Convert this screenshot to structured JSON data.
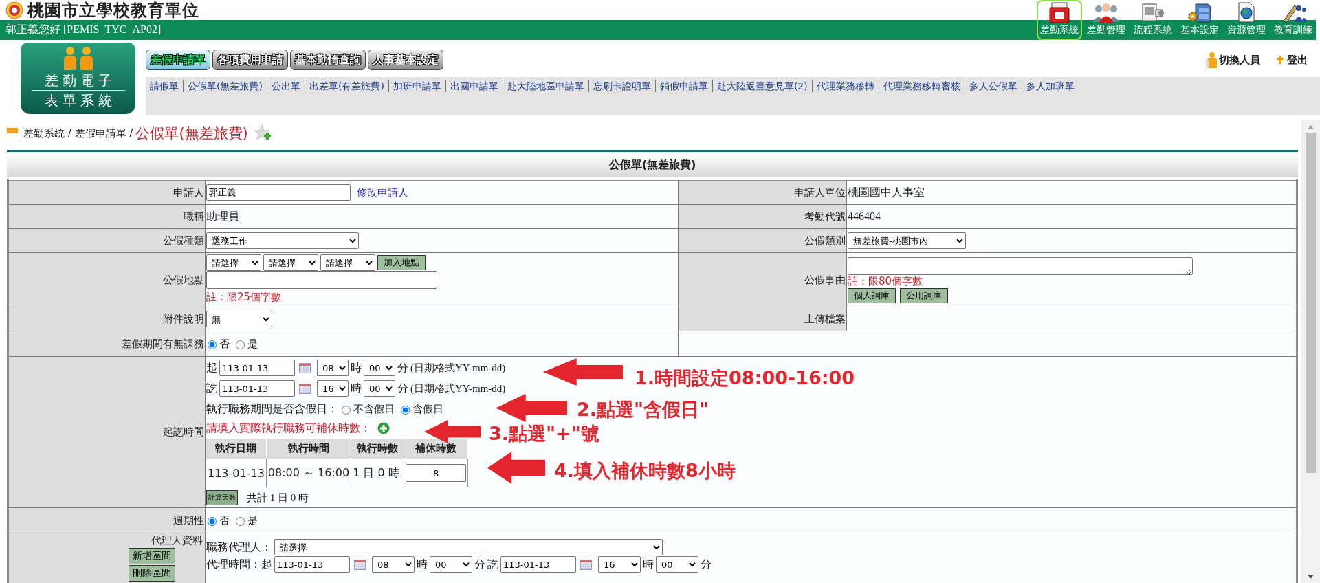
{
  "header": {
    "title": "桃園市立學校教育單位",
    "greeting": "郭正義您好 [PEMIS_TYC_AP02]",
    "systems": [
      {
        "label": "差勤系統",
        "selected": true
      },
      {
        "label": "差勤管理",
        "selected": false
      },
      {
        "label": "流程系統",
        "selected": false
      },
      {
        "label": "基本設定",
        "selected": false
      },
      {
        "label": "資源管理",
        "selected": false
      },
      {
        "label": "教育訓練",
        "selected": false
      }
    ]
  },
  "menu": {
    "logo_lines": [
      "差勤電子",
      "表單系統"
    ],
    "tabs": [
      {
        "label": "差假申請單",
        "selected": true
      },
      {
        "label": "各項費用申請",
        "selected": false
      },
      {
        "label": "基本勤惰查詢",
        "selected": false
      },
      {
        "label": "人事基本設定",
        "selected": false
      }
    ],
    "user_actions": [
      "切換人員",
      "登出"
    ],
    "form_links": [
      "請假單",
      "公假單(無差旅費)",
      "公出單",
      "出差單(有差旅費)",
      "加班申請單",
      "出國申請單",
      "赴大陸地區申請單",
      "忘刷卡證明單",
      "銷假申請單",
      "赴大陸返臺意見單(2)",
      "代理業務移轉",
      "代理業務移轉審核",
      "多人公假單",
      "多人加班單"
    ]
  },
  "breadcrumb": {
    "path": "差勤系統 / 差假申請單 /",
    "current": "公假單(無差旅費)"
  },
  "form": {
    "title": "公假單(無差旅費)",
    "applicant": {
      "label": "申請人",
      "value": "郭正義",
      "link": "修改申請人"
    },
    "applicant_unit": {
      "label": "申請人單位",
      "value": "桃園國中人事室"
    },
    "job_title": {
      "label": "職稱",
      "value": "助理員"
    },
    "attendance_code": {
      "label": "考勤代號",
      "value": "446404"
    },
    "leave_type": {
      "label": "公假種類",
      "value": "選務工作"
    },
    "leave_category": {
      "label": "公假類別",
      "value": "無差旅費-桃園市內"
    },
    "location": {
      "label": "公假地點",
      "selects": [
        "請選擇",
        "請選擇",
        "請選擇"
      ],
      "button": "加入地點",
      "note": "註：限25個字數"
    },
    "reason": {
      "label": "公假事由",
      "note": "註：限80個字數",
      "buttons": [
        "個人詞庫",
        "公用詞庫"
      ]
    },
    "attachment": {
      "label": "附件說明",
      "value": "無"
    },
    "upload": {
      "label": "上傳檔案"
    },
    "classes_during_leave": {
      "label": "差假期間有無課務",
      "options": [
        {
          "label": "否",
          "selected": true
        },
        {
          "label": "是",
          "selected": false
        }
      ]
    },
    "period": {
      "label": "起訖時間",
      "start": {
        "prefix": "起",
        "date": "113-01-13",
        "hour": "08",
        "hour_unit": "時",
        "minute": "00",
        "minute_unit": "分",
        "hint": "(日期格式YY-mm-dd)"
      },
      "end": {
        "prefix": "訖",
        "date": "113-01-13",
        "hour": "16",
        "hour_unit": "時",
        "minute": "00",
        "minute_unit": "分",
        "hint": "(日期格式YY-mm-dd)"
      },
      "holiday": {
        "question": "執行職務期間是否含假日：",
        "options": [
          {
            "label": "不含假日",
            "selected": false
          },
          {
            "label": "含假日",
            "selected": true
          }
        ]
      },
      "comp_prompt": "請填入實際執行職務可補休時數：",
      "comp_table": {
        "columns": [
          "執行日期",
          "執行時間",
          "執行時數",
          "補休時數"
        ],
        "rows": [
          {
            "date": "113-01-13",
            "time": "08:00 ～ 16:00",
            "duration": "1 日 0 時",
            "comp_hours": "8"
          }
        ]
      },
      "calc_button": "計算天數",
      "total": "共計 1 日 0 時",
      "annotations": [
        {
          "text": "1.時間設定08:00-16:00"
        },
        {
          "text": "2.點選\"含假日\""
        },
        {
          "text": "3.點選\"+\"號"
        },
        {
          "text": "4.填入補休時數8小時"
        }
      ]
    },
    "recurring": {
      "label": "週期性",
      "options": [
        {
          "label": "否",
          "selected": true
        },
        {
          "label": "是",
          "selected": false
        }
      ]
    },
    "agent": {
      "label": "代理人資料",
      "buttons": [
        "新增區間",
        "刪除區間"
      ],
      "agent_label": "職務代理人：",
      "agent_value": "請選擇",
      "time_label": "代理時間：起",
      "start": {
        "date": "113-01-13",
        "hour": "08",
        "hour_unit": "時",
        "minute": "00",
        "minute_unit": "分"
      },
      "end_prefix": "訖",
      "end": {
        "date": "113-01-13",
        "hour": "16",
        "hour_unit": "時",
        "minute": "00",
        "minute_unit": "分"
      }
    }
  }
}
